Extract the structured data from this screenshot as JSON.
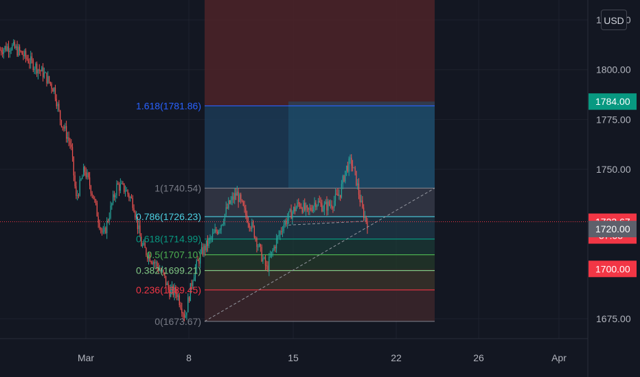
{
  "currency": "USD",
  "price_axis": {
    "ticks": [
      "1825.00",
      "1800.00",
      "1775.00",
      "1750.00",
      "1675.00"
    ]
  },
  "time_axis": {
    "ticks": [
      "Mar",
      "8",
      "15",
      "22",
      "26",
      "Apr"
    ]
  },
  "price_tags": {
    "upper_level": "1784.00",
    "last_price": "1723.67",
    "countdown": "37:58",
    "mid_level": "1720.00",
    "lower_level": "1700.00"
  },
  "colors": {
    "background": "#131722",
    "up": "#26a69a",
    "down": "#ef5350",
    "teal_tag": "#089981",
    "red_tag": "#f23645",
    "grey_tag": "#5d606b"
  },
  "chart_data": {
    "type": "candlestick",
    "y_range": [
      1665,
      1835
    ],
    "fib_retracement": {
      "levels": [
        {
          "ratio": 1.618,
          "price": 1781.86,
          "label": "1.618(1781.86)",
          "color": "#2962ff"
        },
        {
          "ratio": 1,
          "price": 1740.54,
          "label": "1(1740.54)",
          "color": "#787b86"
        },
        {
          "ratio": 0.786,
          "price": 1726.23,
          "label": "0.786(1726.23)",
          "color": "#4dd0e1"
        },
        {
          "ratio": 0.618,
          "price": 1714.99,
          "label": "0.618(1714.99)",
          "color": "#089981"
        },
        {
          "ratio": 0.5,
          "price": 1707.1,
          "label": "0.5(1707.10)",
          "color": "#4caf50"
        },
        {
          "ratio": 0.382,
          "price": 1699.21,
          "label": "0.382(1699.21)",
          "color": "#81c784"
        },
        {
          "ratio": 0.236,
          "price": 1689.45,
          "label": "0.236(1689.45)",
          "color": "#f23645"
        },
        {
          "ratio": 0,
          "price": 1673.67,
          "label": "0(1673.67)",
          "color": "#787b86"
        }
      ]
    },
    "price_path": [
      [
        0,
        1810
      ],
      [
        0.02,
        1812
      ],
      [
        0.04,
        1808
      ],
      [
        0.06,
        1803
      ],
      [
        0.08,
        1798
      ],
      [
        0.1,
        1790
      ],
      [
        0.11,
        1776
      ],
      [
        0.13,
        1762
      ],
      [
        0.14,
        1735
      ],
      [
        0.155,
        1750
      ],
      [
        0.17,
        1738
      ],
      [
        0.18,
        1726
      ],
      [
        0.19,
        1716
      ],
      [
        0.205,
        1732
      ],
      [
        0.215,
        1742
      ],
      [
        0.23,
        1740
      ],
      [
        0.245,
        1733
      ],
      [
        0.26,
        1712
      ],
      [
        0.27,
        1708
      ],
      [
        0.285,
        1703
      ],
      [
        0.3,
        1697
      ],
      [
        0.31,
        1689
      ],
      [
        0.325,
        1688
      ],
      [
        0.34,
        1676
      ],
      [
        0.355,
        1697
      ],
      [
        0.37,
        1708
      ],
      [
        0.39,
        1716
      ],
      [
        0.405,
        1722
      ],
      [
        0.42,
        1732
      ],
      [
        0.435,
        1738
      ],
      [
        0.45,
        1728
      ],
      [
        0.465,
        1720
      ],
      [
        0.48,
        1707
      ],
      [
        0.49,
        1700
      ],
      [
        0.505,
        1712
      ],
      [
        0.52,
        1722
      ],
      [
        0.535,
        1728
      ],
      [
        0.55,
        1733
      ],
      [
        0.565,
        1728
      ],
      [
        0.58,
        1734
      ],
      [
        0.595,
        1731
      ],
      [
        0.61,
        1733
      ],
      [
        0.625,
        1738
      ],
      [
        0.635,
        1750
      ],
      [
        0.645,
        1754
      ],
      [
        0.655,
        1744
      ],
      [
        0.665,
        1730
      ],
      [
        0.675,
        1723
      ]
    ]
  }
}
